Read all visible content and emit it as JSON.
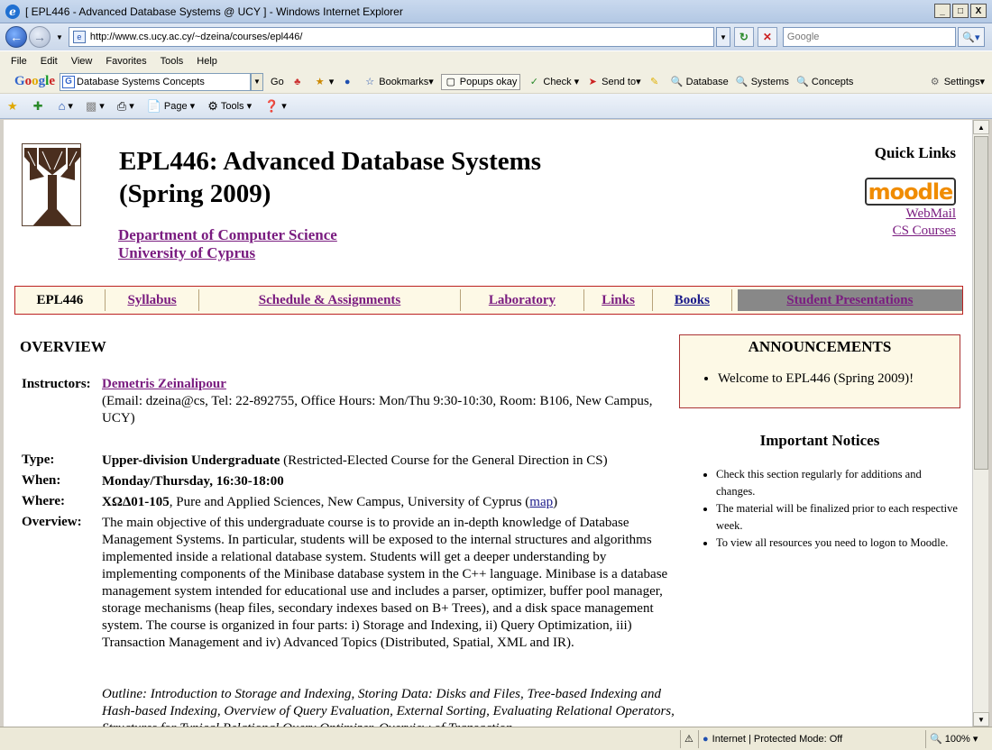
{
  "window": {
    "title": "[ EPL446 - Advanced Database Systems @ UCY ] - Windows Internet Explorer",
    "minimize": "_",
    "maximize": "□",
    "close": "X"
  },
  "address": {
    "url": "http://www.cs.ucy.ac.cy/~dzeina/courses/epl446/",
    "search_placeholder": "Google"
  },
  "menu": [
    "File",
    "Edit",
    "View",
    "Favorites",
    "Tools",
    "Help"
  ],
  "google_toolbar": {
    "search_value": "Database Systems Concepts",
    "go_label": "Go",
    "bookmarks": "Bookmarks",
    "popups": "Popups okay",
    "check": "Check",
    "send_to": "Send to",
    "database": "Database",
    "systems": "Systems",
    "concepts": "Concepts",
    "settings": "Settings"
  },
  "command_bar": {
    "page": "Page",
    "tools": "Tools"
  },
  "page": {
    "title": "EPL446: Advanced Database Systems (Spring 2009)",
    "department": "Department of Computer Science",
    "university": "University of Cyprus",
    "quick_links_title": "Quick Links",
    "moodle": "moodle",
    "webmail": "WebMail",
    "cs_courses": "CS Courses"
  },
  "nav": {
    "current": "EPL446",
    "syllabus": "Syllabus",
    "schedule": "Schedule & Assignments",
    "laboratory": "Laboratory",
    "links": "Links",
    "books": "Books",
    "presentations": "Student Presentations"
  },
  "overview": {
    "heading": "OVERVIEW",
    "instructors_label": "Instructors:",
    "instructor_name": "Demetris Zeinalipour",
    "instructor_details": "(Email: dzeina@cs, Tel: 22-892755, Office Hours: Mon/Thu 9:30-10:30, Room: B106, New Campus, UCY)",
    "type_label": "Type:",
    "type_bold": "Upper-division Undergraduate",
    "type_rest": " (Restricted-Elected Course for the General Direction in CS)",
    "when_label": "When:",
    "when_value": "Monday/Thursday, 16:30-18:00",
    "where_label": "Where:",
    "where_bold": "ΧΩΔ01-105",
    "where_rest": ", Pure and Applied Sciences, New Campus, University of Cyprus (",
    "map": "map",
    "where_close": ")",
    "overview_label": "Overview:",
    "overview_text": "The main objective of this undergraduate course is to provide an in-depth knowledge of Database Management Systems. In particular, students will be exposed to the internal structures and algorithms implemented inside a relational database system. Students will get a deeper understanding by implementing  components of  the Minibase database system in the C++ language. Minibase is a database management system intended for educational use and includes a parser, optimizer, buffer pool manager, storage mechanisms (heap files, secondary indexes based on B+ Trees), and a disk space management system. The course is organized in four parts: i) Storage and Indexing, ii) Query Optimization, iii) Transaction Management and iv) Advanced Topics (Distributed, Spatial, XML and IR).",
    "outline_text": "Outline: Introduction to Storage and Indexing, Storing Data: Disks and Files, Tree-based Indexing and Hash-based Indexing, Overview of Query Evaluation, External Sorting, Evaluating Relational Operators, Structures for Typical Relational Query Optimizer, Overview of Transaction"
  },
  "announcements": {
    "heading": "ANNOUNCEMENTS",
    "items": [
      "Welcome to EPL446 (Spring 2009)!"
    ]
  },
  "notices": {
    "heading": "Important Notices",
    "items": [
      "Check this section regularly for additions and changes.",
      "The material will be finalized prior to each respective week.",
      "To view all resources you need to logon to Moodle."
    ]
  },
  "status": {
    "zone": "Internet | Protected Mode: Off",
    "zoom": "100%"
  }
}
